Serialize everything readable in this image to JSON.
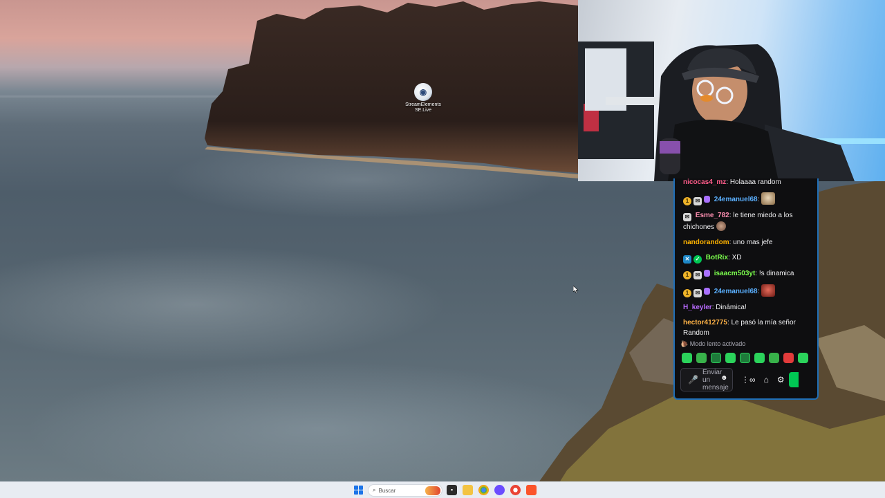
{
  "desktop": {
    "shortcut": {
      "label_line1": "StreamElements",
      "label_line2": "SE.Live",
      "icon": "streamelements-icon"
    }
  },
  "chat": {
    "messages": [
      {
        "user": "nicocas4_mz",
        "color": "#ff5c8a",
        "badges": [],
        "text": "Holaaaa random"
      },
      {
        "user": "24emanuel68",
        "color": "#5bb0ff",
        "badges": [
          "gold-badge",
          "grey-badge",
          "sub-gift-badge"
        ],
        "text": "",
        "emote": "cat-emote"
      },
      {
        "user": "Esme_782",
        "color": "#ff8fb1",
        "badges": [
          "grey-badge"
        ],
        "text": "le tiene miedo a los chichones",
        "emote": "small-emote"
      },
      {
        "user": "nandorandom",
        "color": "#ffb300",
        "badges": [],
        "text": "uno mas jefe"
      },
      {
        "user": "BotRix",
        "color": "#7cff4d",
        "badges": [
          "bot-badge",
          "verified-badge"
        ],
        "text": "XD"
      },
      {
        "user": "isaacm503yt",
        "color": "#7cff4d",
        "badges": [
          "gold-badge",
          "grey-badge",
          "sub-gift-badge"
        ],
        "text": "!s dinamica"
      },
      {
        "user": "24emanuel68",
        "color": "#5bb0ff",
        "badges": [
          "gold-badge",
          "grey-badge",
          "sub-gift-badge"
        ],
        "text": "",
        "emote": "face-emote"
      },
      {
        "user": "H_keyler",
        "color": "#b96bff",
        "badges": [],
        "text": "Dinámica!"
      },
      {
        "user": "hector412775",
        "color": "#ffb347",
        "badges": [],
        "text": "Le pasó la mía señor Random"
      }
    ],
    "slow_mode": "Modo lento activado",
    "input_placeholder": "Enviar un mensaje",
    "badge_glyphs": {
      "gold": "1",
      "grey": "✉",
      "bot": "✕",
      "verified": "✓"
    }
  },
  "taskbar": {
    "search_placeholder": "Buscar"
  }
}
